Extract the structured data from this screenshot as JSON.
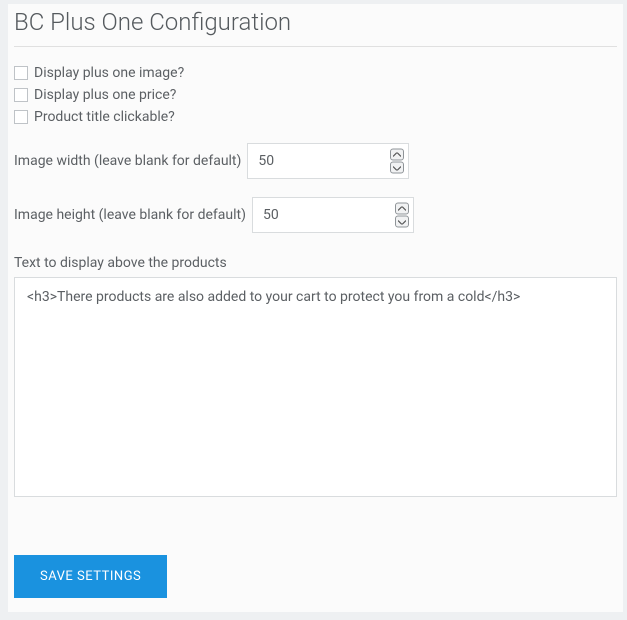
{
  "title": "BC Plus One Configuration",
  "checkboxes": [
    {
      "label": "Display plus one image?",
      "checked": false
    },
    {
      "label": "Display plus one price?",
      "checked": false
    },
    {
      "label": "Product title clickable?",
      "checked": false
    }
  ],
  "imageWidth": {
    "label": "Image width (leave blank for default)",
    "value": "50"
  },
  "imageHeight": {
    "label": "Image height (leave blank for default)",
    "value": "50"
  },
  "textAbove": {
    "label": "Text to display above the products",
    "value": "<h3>There products are also added to your cart to protect you from a cold</h3>"
  },
  "saveLabel": "SAVE SETTINGS"
}
